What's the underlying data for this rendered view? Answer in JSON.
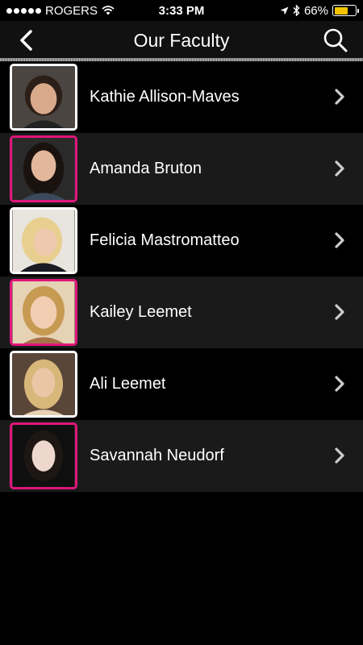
{
  "status_bar": {
    "carrier": "ROGERS",
    "time": "3:33 PM",
    "battery_percent": "66%",
    "battery_level": 0.66,
    "battery_color": "#f5c400"
  },
  "nav": {
    "title": "Our Faculty",
    "back_icon": "chevron-left-icon",
    "search_icon": "search-icon"
  },
  "faculty": [
    {
      "name": "Kathie Allison-Maves",
      "border_color": "#ffffff"
    },
    {
      "name": "Amanda Bruton",
      "border_color": "#e0167a"
    },
    {
      "name": "Felicia Mastromatteo",
      "border_color": "#ffffff"
    },
    {
      "name": "Kailey Leemet",
      "border_color": "#e0167a"
    },
    {
      "name": "Ali Leemet",
      "border_color": "#ffffff"
    },
    {
      "name": "Savannah Neudorf",
      "border_color": "#e0167a"
    }
  ],
  "colors": {
    "accent_pink": "#e0167a",
    "row_alt": "#1a1a1a"
  }
}
